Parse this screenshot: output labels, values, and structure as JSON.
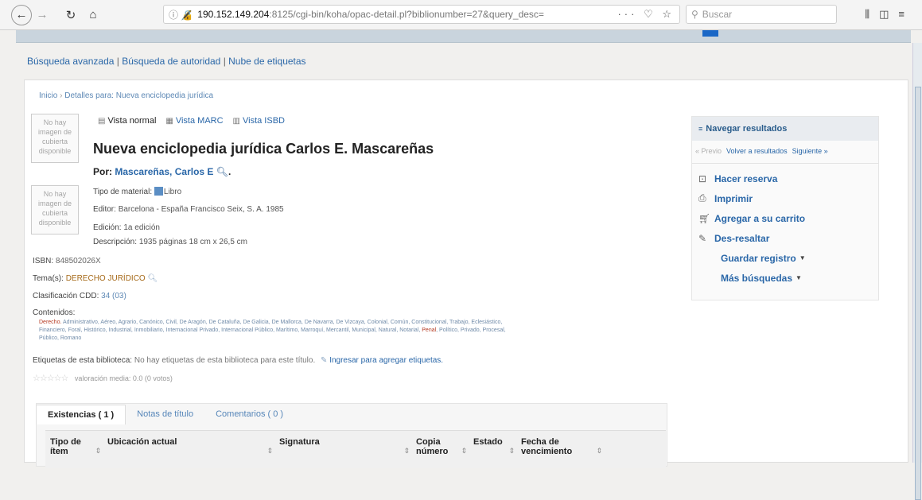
{
  "browser": {
    "url_prefix": "ⓘ 🔏",
    "url_host": "190.152.149.204",
    "url_rest": ":8125/cgi-bin/koha/opac-detail.pl?biblionumber=27&query_desc=",
    "url_actions": "··· ♡ ☆",
    "search_placeholder": "Buscar"
  },
  "toplinks": {
    "advanced": "Búsqueda avanzada",
    "authority": "Búsqueda de autoridad",
    "tagcloud": "Nube de etiquetas"
  },
  "breadcrumb": {
    "home": "Inicio",
    "current": "Detalles para: Nueva enciclopedia jurídica"
  },
  "cover": {
    "line1": "No hay",
    "line2": "imagen de",
    "line3": "cubierta",
    "line4": "disponible"
  },
  "view_tabs": {
    "normal": "Vista normal",
    "marc": "Vista MARC",
    "isbd": "Vista ISBD"
  },
  "record": {
    "title": "Nueva enciclopedia jurídica Carlos E. Mascareñas",
    "by_label": "Por:",
    "author": "Mascareñas, Carlos E",
    "material_label": "Tipo de material:",
    "material_value": "Libro",
    "publisher_label": "Editor:",
    "publisher_value": "Barcelona - España Francisco Seix, S. A. 1985",
    "edition_label": "Edición:",
    "edition_value": "1a edición",
    "description_label": "Descripción:",
    "description_value": "1935 páginas 18 cm x 26,5 cm",
    "isbn_label": "ISBN:",
    "isbn_value": "848502026X",
    "subject_label": "Tema(s):",
    "subject_value": "DERECHO JURÍDICO",
    "classification_label": "Clasificación CDD:",
    "classification_value": "34 (03)",
    "contents_label": "Contenidos:",
    "contents_hl1": "Derecho.",
    "contents_text1": " Administrativo, Aéreo, Agrario, Canónico, Civil, De Aragón, De Cataluña, De Galicia, De Mallorca, De Navarra, De Vizcaya, Colonial, Común, Constitucional, Trabajo, Eclesiástico, Financiero, Foral, Histórico, Industrial, Inmobiliario, Internacional Privado, Internacional Público, Marítimo, Marroquí, Mercantil, Municipal, Natural, Notarial, ",
    "contents_hl2": "Penal",
    "contents_text2": ", Político, Privado, Procesal, Público, Romano",
    "tags_label": "Etiquetas de esta biblioteca:",
    "tags_text": "No hay etiquetas de esta biblioteca para este título.",
    "tags_link": "Ingresar para agregar etiquetas.",
    "rating_text": "valoración media: 0.0 (0 votos)"
  },
  "holdings_tabs": {
    "existencias": "Existencias ( 1 )",
    "notas": "Notas de título",
    "comentarios": "Comentarios ( 0 )"
  },
  "table_headers": {
    "tipo": "Tipo de ítem",
    "ubicacion": "Ubicación actual",
    "signatura": "Signatura",
    "copia": "Copia número",
    "estado": "Estado",
    "fecha": "Fecha de vencimiento"
  },
  "sidebar": {
    "header": "Navegar resultados",
    "prev": "« Previo",
    "back": "Volver a resultados",
    "next": "Siguiente »",
    "reserve": "Hacer reserva",
    "print": "Imprimir",
    "cart": "Agregar a su carrito",
    "unhighlight": "Des-resaltar",
    "save": "Guardar registro",
    "more": "Más búsquedas"
  }
}
